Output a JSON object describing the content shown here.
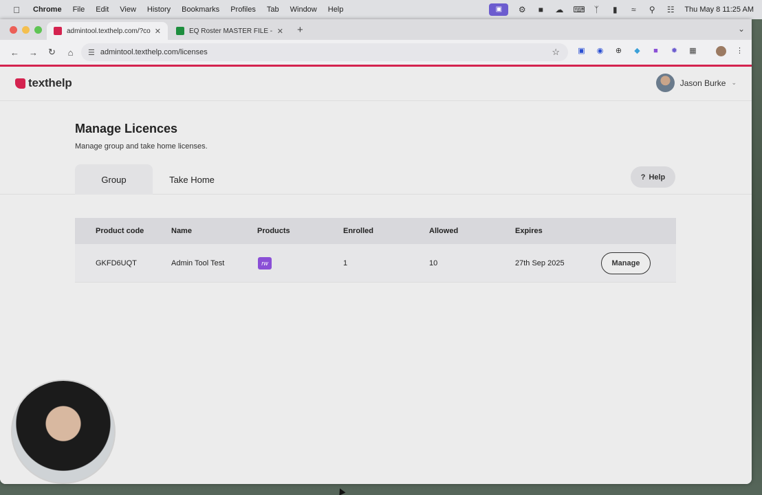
{
  "menubar": {
    "app": "Chrome",
    "items": [
      "File",
      "Edit",
      "View",
      "History",
      "Bookmarks",
      "Profiles",
      "Tab",
      "Window",
      "Help"
    ],
    "clock": "Thu May 8  11:25 AM"
  },
  "browser": {
    "tabs": [
      {
        "title": "admintool.texthelp.com/?cod",
        "favicon_color": "#d4234f"
      },
      {
        "title": "EQ Roster MASTER FILE - Go",
        "favicon_color": "#1e8e3e"
      }
    ],
    "url": "admintool.texthelp.com/licenses"
  },
  "header": {
    "logo_text": "texthelp",
    "user_name": "Jason Burke"
  },
  "page": {
    "title": "Manage Licences",
    "subtitle": "Manage group and take home licenses.",
    "tabs": [
      {
        "label": "Group"
      },
      {
        "label": "Take Home"
      }
    ],
    "help_label": "Help"
  },
  "table": {
    "columns": [
      "Product code",
      "Name",
      "Products",
      "Enrolled",
      "Allowed",
      "Expires"
    ],
    "rows": [
      {
        "product_code": "GKFD6UQT",
        "name": "Admin Tool Test",
        "product_icon_text": "rw",
        "enrolled": "1",
        "allowed": "10",
        "expires": "27th Sep 2025",
        "action_label": "Manage"
      }
    ]
  },
  "colors": {
    "brand": "#d4234f",
    "product_icon": "#8a4fd6"
  }
}
